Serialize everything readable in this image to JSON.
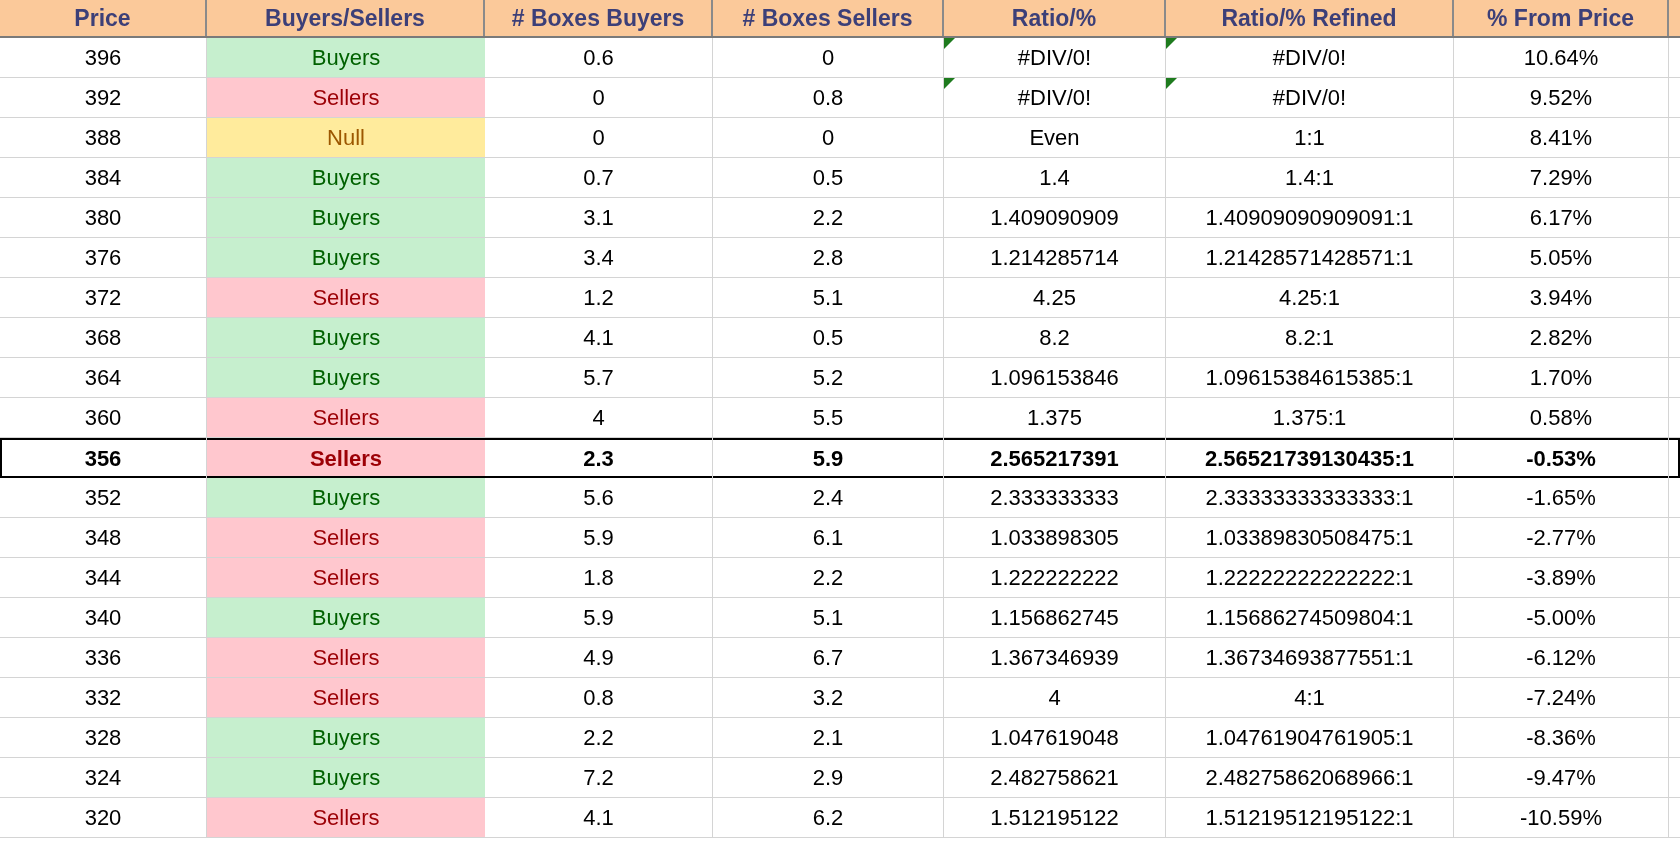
{
  "columns": [
    "Price",
    "Buyers/Sellers",
    "# Boxes Buyers",
    "# Boxes Sellers",
    "Ratio/%",
    "Ratio/% Refined",
    "% From Price"
  ],
  "rows": [
    {
      "price": "396",
      "side": {
        "label": "Buyers",
        "kind": "buyers"
      },
      "boxes_buyers": "0.6",
      "boxes_sellers": "0",
      "ratio": {
        "text": "#DIV/0!",
        "flagged": true
      },
      "refined": {
        "text": "#DIV/0!",
        "flagged": true
      },
      "from_price": "10.64%",
      "selected": false
    },
    {
      "price": "392",
      "side": {
        "label": "Sellers",
        "kind": "sellers"
      },
      "boxes_buyers": "0",
      "boxes_sellers": "0.8",
      "ratio": {
        "text": "#DIV/0!",
        "flagged": true
      },
      "refined": {
        "text": "#DIV/0!",
        "flagged": true
      },
      "from_price": "9.52%",
      "selected": false
    },
    {
      "price": "388",
      "side": {
        "label": "Null",
        "kind": "null"
      },
      "boxes_buyers": "0",
      "boxes_sellers": "0",
      "ratio": {
        "text": "Even",
        "flagged": false
      },
      "refined": {
        "text": "1:1",
        "flagged": false
      },
      "from_price": "8.41%",
      "selected": false
    },
    {
      "price": "384",
      "side": {
        "label": "Buyers",
        "kind": "buyers"
      },
      "boxes_buyers": "0.7",
      "boxes_sellers": "0.5",
      "ratio": {
        "text": "1.4",
        "flagged": false
      },
      "refined": {
        "text": "1.4:1",
        "flagged": false
      },
      "from_price": "7.29%",
      "selected": false
    },
    {
      "price": "380",
      "side": {
        "label": "Buyers",
        "kind": "buyers"
      },
      "boxes_buyers": "3.1",
      "boxes_sellers": "2.2",
      "ratio": {
        "text": "1.409090909",
        "flagged": false
      },
      "refined": {
        "text": "1.40909090909091:1",
        "flagged": false
      },
      "from_price": "6.17%",
      "selected": false
    },
    {
      "price": "376",
      "side": {
        "label": "Buyers",
        "kind": "buyers"
      },
      "boxes_buyers": "3.4",
      "boxes_sellers": "2.8",
      "ratio": {
        "text": "1.214285714",
        "flagged": false
      },
      "refined": {
        "text": "1.21428571428571:1",
        "flagged": false
      },
      "from_price": "5.05%",
      "selected": false
    },
    {
      "price": "372",
      "side": {
        "label": "Sellers",
        "kind": "sellers"
      },
      "boxes_buyers": "1.2",
      "boxes_sellers": "5.1",
      "ratio": {
        "text": "4.25",
        "flagged": false
      },
      "refined": {
        "text": "4.25:1",
        "flagged": false
      },
      "from_price": "3.94%",
      "selected": false
    },
    {
      "price": "368",
      "side": {
        "label": "Buyers",
        "kind": "buyers"
      },
      "boxes_buyers": "4.1",
      "boxes_sellers": "0.5",
      "ratio": {
        "text": "8.2",
        "flagged": false
      },
      "refined": {
        "text": "8.2:1",
        "flagged": false
      },
      "from_price": "2.82%",
      "selected": false
    },
    {
      "price": "364",
      "side": {
        "label": "Buyers",
        "kind": "buyers"
      },
      "boxes_buyers": "5.7",
      "boxes_sellers": "5.2",
      "ratio": {
        "text": "1.096153846",
        "flagged": false
      },
      "refined": {
        "text": "1.09615384615385:1",
        "flagged": false
      },
      "from_price": "1.70%",
      "selected": false
    },
    {
      "price": "360",
      "side": {
        "label": "Sellers",
        "kind": "sellers"
      },
      "boxes_buyers": "4",
      "boxes_sellers": "5.5",
      "ratio": {
        "text": "1.375",
        "flagged": false
      },
      "refined": {
        "text": "1.375:1",
        "flagged": false
      },
      "from_price": "0.58%",
      "selected": false
    },
    {
      "price": "356",
      "side": {
        "label": "Sellers",
        "kind": "sellers"
      },
      "boxes_buyers": "2.3",
      "boxes_sellers": "5.9",
      "ratio": {
        "text": "2.565217391",
        "flagged": false
      },
      "refined": {
        "text": "2.56521739130435:1",
        "flagged": false
      },
      "from_price": "-0.53%",
      "selected": true
    },
    {
      "price": "352",
      "side": {
        "label": "Buyers",
        "kind": "buyers"
      },
      "boxes_buyers": "5.6",
      "boxes_sellers": "2.4",
      "ratio": {
        "text": "2.333333333",
        "flagged": false
      },
      "refined": {
        "text": "2.33333333333333:1",
        "flagged": false
      },
      "from_price": "-1.65%",
      "selected": false
    },
    {
      "price": "348",
      "side": {
        "label": "Sellers",
        "kind": "sellers"
      },
      "boxes_buyers": "5.9",
      "boxes_sellers": "6.1",
      "ratio": {
        "text": "1.033898305",
        "flagged": false
      },
      "refined": {
        "text": "1.03389830508475:1",
        "flagged": false
      },
      "from_price": "-2.77%",
      "selected": false
    },
    {
      "price": "344",
      "side": {
        "label": "Sellers",
        "kind": "sellers"
      },
      "boxes_buyers": "1.8",
      "boxes_sellers": "2.2",
      "ratio": {
        "text": "1.222222222",
        "flagged": false
      },
      "refined": {
        "text": "1.22222222222222:1",
        "flagged": false
      },
      "from_price": "-3.89%",
      "selected": false
    },
    {
      "price": "340",
      "side": {
        "label": "Buyers",
        "kind": "buyers"
      },
      "boxes_buyers": "5.9",
      "boxes_sellers": "5.1",
      "ratio": {
        "text": "1.156862745",
        "flagged": false
      },
      "refined": {
        "text": "1.15686274509804:1",
        "flagged": false
      },
      "from_price": "-5.00%",
      "selected": false
    },
    {
      "price": "336",
      "side": {
        "label": "Sellers",
        "kind": "sellers"
      },
      "boxes_buyers": "4.9",
      "boxes_sellers": "6.7",
      "ratio": {
        "text": "1.367346939",
        "flagged": false
      },
      "refined": {
        "text": "1.36734693877551:1",
        "flagged": false
      },
      "from_price": "-6.12%",
      "selected": false
    },
    {
      "price": "332",
      "side": {
        "label": "Sellers",
        "kind": "sellers"
      },
      "boxes_buyers": "0.8",
      "boxes_sellers": "3.2",
      "ratio": {
        "text": "4",
        "flagged": false
      },
      "refined": {
        "text": "4:1",
        "flagged": false
      },
      "from_price": "-7.24%",
      "selected": false
    },
    {
      "price": "328",
      "side": {
        "label": "Buyers",
        "kind": "buyers"
      },
      "boxes_buyers": "2.2",
      "boxes_sellers": "2.1",
      "ratio": {
        "text": "1.047619048",
        "flagged": false
      },
      "refined": {
        "text": "1.04761904761905:1",
        "flagged": false
      },
      "from_price": "-8.36%",
      "selected": false
    },
    {
      "price": "324",
      "side": {
        "label": "Buyers",
        "kind": "buyers"
      },
      "boxes_buyers": "7.2",
      "boxes_sellers": "2.9",
      "ratio": {
        "text": "2.482758621",
        "flagged": false
      },
      "refined": {
        "text": "2.48275862068966:1",
        "flagged": false
      },
      "from_price": "-9.47%",
      "selected": false
    },
    {
      "price": "320",
      "side": {
        "label": "Sellers",
        "kind": "sellers"
      },
      "boxes_buyers": "4.1",
      "boxes_sellers": "6.2",
      "ratio": {
        "text": "1.512195122",
        "flagged": false
      },
      "refined": {
        "text": "1.51219512195122:1",
        "flagged": false
      },
      "from_price": "-10.59%",
      "selected": false
    }
  ]
}
